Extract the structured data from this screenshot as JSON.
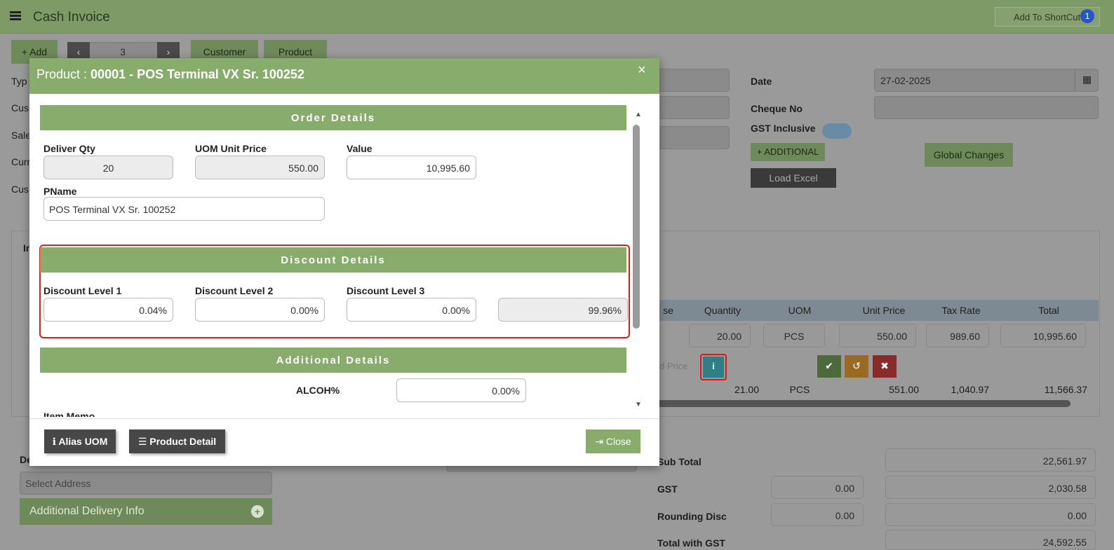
{
  "app": {
    "title": "Cash Invoice",
    "shortcut_label": "Add To ShortCut",
    "shortcut_badge": "1"
  },
  "toolbar": {
    "add": "+ Add",
    "record_no": "3",
    "customer": "Customer",
    "product": "Product"
  },
  "bg_labels": {
    "type": "Typ",
    "cust": "Cus",
    "sale": "Sale",
    "curr": "Curr",
    "cust2": "Cus",
    "inv_tab": "In"
  },
  "right_form": {
    "date_label": "Date",
    "date_value": "27-02-2025",
    "cheque_label": "Cheque No",
    "gst_label": "GST Inclusive",
    "additional_btn": "+ ADDITIONAL",
    "global_btn": "Global Changes",
    "load_excel_btn": "Load Excel"
  },
  "table": {
    "headers": [
      "se",
      "Quantity",
      "UOM",
      "Unit Price",
      "Tax Rate",
      "Total"
    ],
    "edit_row": {
      "qty": "20.00",
      "uom": "PCS",
      "unit_price": "550.00",
      "tax": "989.60",
      "total": "10,995.60",
      "price_placeholder": "d Price"
    },
    "row2": {
      "qty": "21.00",
      "uom": "PCS",
      "unit_price": "551.00",
      "tax": "1,040.97",
      "total": "11,566.37"
    }
  },
  "totals": {
    "sub_total_label": "Sub Total",
    "sub_total": "22,561.97",
    "gst_label": "GST",
    "gst_rate": "0.00",
    "gst": "2,030.58",
    "rounding_label": "Rounding Disc",
    "rounding_rate": "0.00",
    "rounding": "0.00",
    "total_label": "Total with GST",
    "total": "24,592.55"
  },
  "delivery": {
    "label": "De",
    "select_placeholder": "Select Address",
    "additional_info": "Additional Delivery Info"
  },
  "modal": {
    "title_prefix": "Product : ",
    "title_bold": "00001 - POS Terminal VX Sr. 100252",
    "order_section": "Order Details",
    "deliver_qty_label": "Deliver Qty",
    "deliver_qty": "20",
    "uom_price_label": "UOM Unit Price",
    "uom_price": "550.00",
    "value_label": "Value",
    "value": "10,995.60",
    "pname_label": "PName",
    "pname": "POS Terminal VX Sr. 100252",
    "discount_section": "Discount Details",
    "disc1_label": "Discount Level 1",
    "disc1": "0.04%",
    "disc2_label": "Discount Level 2",
    "disc2": "0.00%",
    "disc3_label": "Discount Level 3",
    "disc3": "0.00%",
    "disc_total": "99.96%",
    "additional_section": "Additional Details",
    "alcoh_label": "ALCOH%",
    "alcoh": "0.00%",
    "memo_label": "Item Memo",
    "alias_btn": "Alias UOM",
    "detail_btn": "Product Detail",
    "close_btn": "Close"
  },
  "colors": {
    "accent": "#88ac6c",
    "dark_button": "#474747",
    "highlight": "#e41a1a",
    "teal": "#3aa6b0"
  }
}
